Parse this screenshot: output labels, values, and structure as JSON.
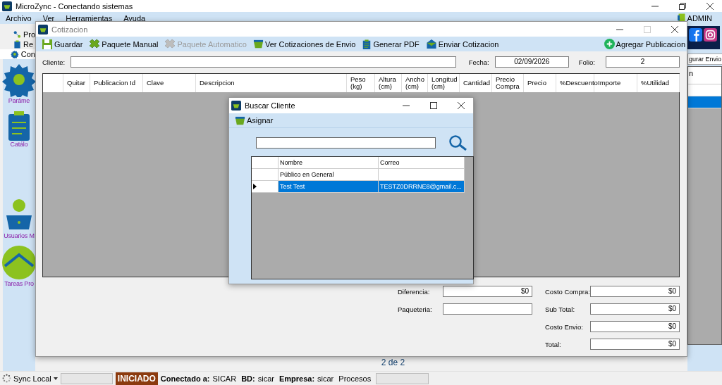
{
  "main_window": {
    "title": "MicroZync - Conectando sistemas",
    "menu": [
      {
        "label": "Archivo"
      },
      {
        "label": "Ver"
      },
      {
        "label": "Herramientas"
      },
      {
        "label": "Ayuda"
      }
    ],
    "user": "ADMIN"
  },
  "side_tabs": [
    {
      "label": "Pro",
      "kind": "flow",
      "selected": false
    },
    {
      "label": "Re",
      "kind": "report",
      "selected": false
    },
    {
      "label": "Con",
      "kind": "cog",
      "selected": true
    }
  ],
  "side_items": [
    {
      "label": "Paráme",
      "kind": "gear"
    },
    {
      "label": "Catálo",
      "kind": "clipboard"
    },
    {
      "label": "Usuarios M",
      "kind": "user"
    },
    {
      "label": "Tareas Pro",
      "kind": "globe"
    }
  ],
  "right_panel": {
    "tab": "gurar Envio",
    "list_header": "n",
    "rows": [
      {
        "selected": false
      },
      {
        "selected": true
      }
    ]
  },
  "pager": "2 de 2",
  "status_bar": {
    "sync": "Sync Local",
    "sync_progress": {
      "level": 0
    },
    "state": "INICIADO",
    "items": [
      {
        "label": "Conectado a:",
        "value": "SICAR"
      },
      {
        "label": "BD:",
        "value": "sicar"
      },
      {
        "label": "Empresa:",
        "value": "sicar"
      }
    ],
    "processes": "Procesos",
    "processes_progress": {
      "level": 0
    }
  },
  "quote_window": {
    "title": "Cotizacion",
    "toolbar": [
      {
        "label": "Guardar",
        "kind": "save",
        "disabled": false
      },
      {
        "label": "Paquete Manual",
        "kind": "package",
        "disabled": false
      },
      {
        "label": "Paquete Automatico",
        "kind": "package",
        "disabled": true
      },
      {
        "label": "Ver Cotizaciones de Envio",
        "kind": "basket",
        "disabled": false
      },
      {
        "label": "Generar PDF",
        "kind": "clipboard",
        "disabled": false
      },
      {
        "label": "Enviar Cotizacion",
        "kind": "envelope",
        "disabled": false
      }
    ],
    "add_button": "Agregar Publicacion",
    "client_label": "Cliente:",
    "date_label": "Fecha:",
    "date": "02/09/2026",
    "folio_label": "Folio:",
    "folio": "2",
    "columns": [
      "Quitar",
      "Publicacion Id",
      "Clave",
      "Descripcion",
      "Peso\n(kg)",
      "Altura\n(cm)",
      "Ancho\n(cm)",
      "Longitud\n(cm)",
      "Cantidad",
      "Precio\nCompra",
      "Precio",
      "%Descuento",
      "Importe",
      "%Utilidad"
    ],
    "totals_left": [
      {
        "label": "Diferencia:",
        "value": "$0"
      },
      {
        "label": "Paqueteria:"
      }
    ],
    "totals_right": [
      {
        "label": "Costo Compra:",
        "value": "$0"
      },
      {
        "label": "Sub Total:",
        "value": "$0"
      },
      {
        "label": "Costo Envio:",
        "value": "$0"
      },
      {
        "label": "Total:",
        "value": "$0"
      }
    ]
  },
  "dialog": {
    "title": "Buscar Cliente",
    "toolbar_button": "Asignar",
    "columns": [
      "Nombre",
      "Correo"
    ],
    "rows": [
      {
        "name": "Público en General",
        "selected": false
      },
      {
        "name": "Test Test",
        "email": "TESTZ0DRRNE8@gmail.c...",
        "selected": true
      }
    ]
  }
}
